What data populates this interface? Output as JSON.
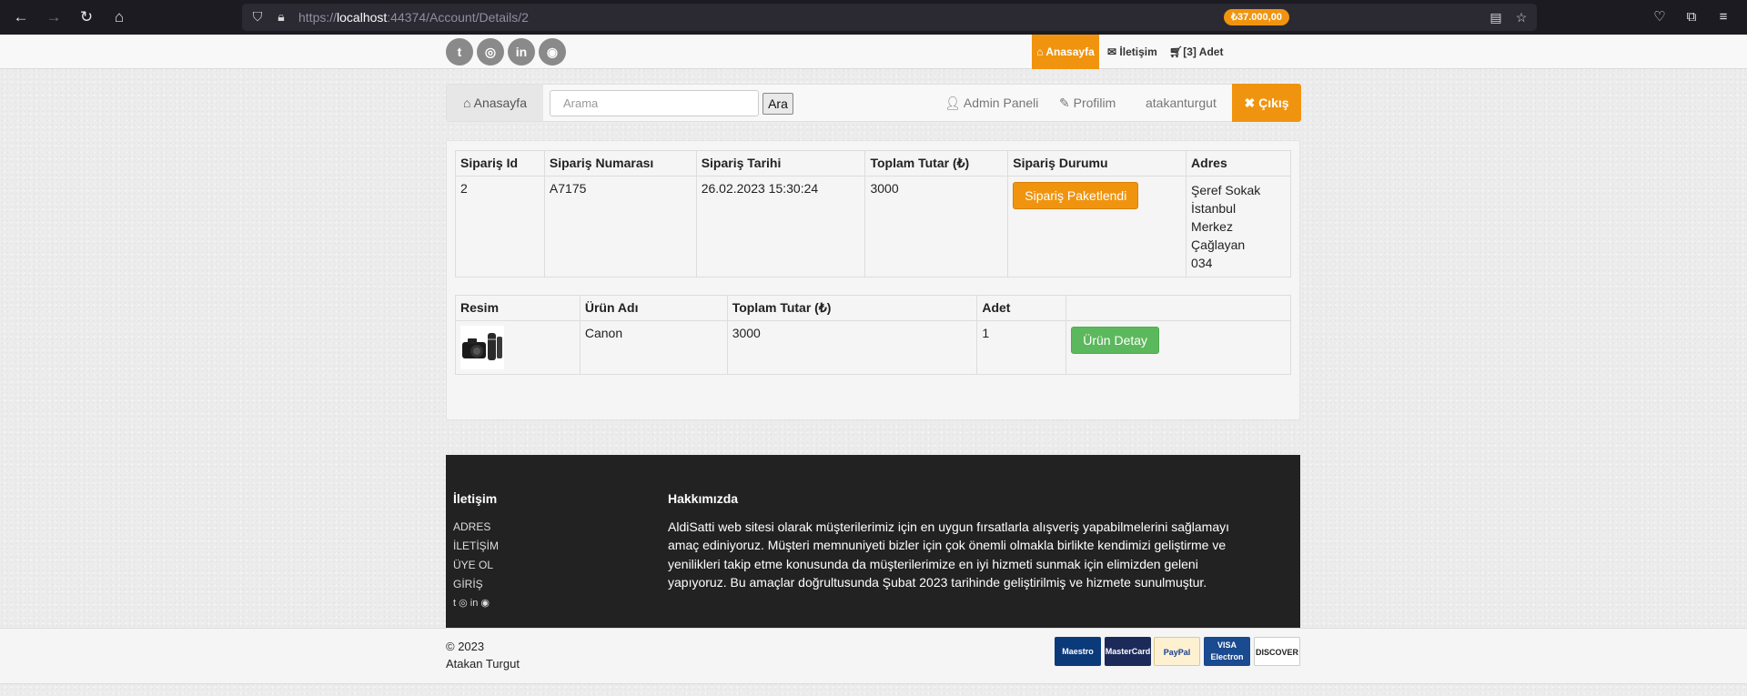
{
  "browser": {
    "url_prefix": "https://",
    "url_host": "localhost",
    "url_rest": ":44374/Account/Details/2"
  },
  "topbar": {
    "social": [
      "twitter-icon",
      "instagram-icon",
      "linkedin-icon",
      "github-icon"
    ],
    "home_label": "Anasayfa",
    "contact_label": "İletişim",
    "cart_label": "[3] Adet",
    "cart_total": "₺37.000,00"
  },
  "navbar": {
    "home_label": "Anasayfa",
    "search_placeholder": "Arama",
    "search_button": "Ara",
    "admin_label": "Admin Paneli",
    "profile_label": "Profilim",
    "username": "atakanturgut",
    "logout_label": "Çıkış"
  },
  "order": {
    "headers": [
      "Sipariş Id",
      "Sipariş Numarası",
      "Sipariş Tarihi",
      "Toplam Tutar (₺)",
      "Sipariş Durumu",
      "Adres"
    ],
    "id": "2",
    "number": "A7175",
    "date": "26.02.2023 15:30:24",
    "total": "3000",
    "status": "Sipariş Paketlendi",
    "address": [
      "Şeref Sokak",
      "İstanbul",
      "Merkez",
      "Çağlayan",
      "034"
    ]
  },
  "items": {
    "headers": [
      "Resim",
      "Ürün Adı",
      "Toplam Tutar (₺)",
      "Adet",
      ""
    ],
    "rows": [
      {
        "name": "Canon",
        "total": "3000",
        "qty": "1",
        "detail_label": "Ürün Detay"
      }
    ]
  },
  "footer": {
    "contact_title": "İletişim",
    "links": [
      "ADRES",
      "İLETİŞİM",
      "ÜYE OL",
      "GİRİŞ"
    ],
    "about_title": "Hakkımızda",
    "about_text": "AldiSatti web sitesi olarak müşterilerimiz için en uygun fırsatlarla alışveriş yapabilmelerini sağlamayı amaç ediniyoruz. Müşteri memnuniyeti bizler için çok önemli olmakla birlikte kendimizi geliştirme ve yenilikleri takip etme konusunda da müşterilerimize en iyi hizmeti sunmak için elimizden geleni yapıyoruz. Bu amaçlar doğrultusunda Şubat 2023 tarihinde geliştirilmiş ve hizmete sunulmuştur."
  },
  "copyright": {
    "line1": "© 2023",
    "line2": "Atakan Turgut"
  },
  "payments": [
    "Maestro",
    "MasterCard",
    "PayPal",
    "VISA Electron",
    "DISCOVER"
  ],
  "colors": {
    "accent": "#f0940f",
    "success": "#5cb85c",
    "footer_bg": "#222222"
  }
}
